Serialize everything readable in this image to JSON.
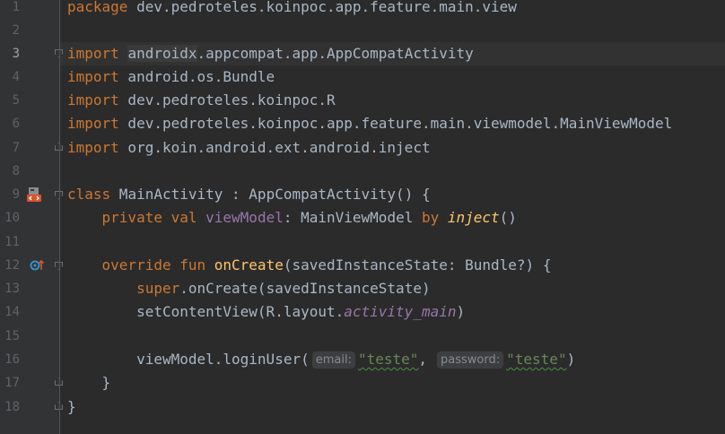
{
  "gutter": {
    "line_numbers": [
      "1",
      "2",
      "3",
      "4",
      "5",
      "6",
      "7",
      "8",
      "9",
      "10",
      "11",
      "12",
      "13",
      "14",
      "15",
      "16",
      "17",
      "18"
    ],
    "current_line": "3"
  },
  "code": {
    "line1": {
      "kw": "package",
      "text": " dev.pedroteles.koinpoc.app.feature.main.view"
    },
    "line3": {
      "kw": "import",
      "sp": " ",
      "hl": "androidx",
      "text": ".appcompat.app.AppCompatActivity"
    },
    "line4": {
      "kw": "import",
      "text": " android.os.Bundle"
    },
    "line5": {
      "kw": "import",
      "text": " dev.pedroteles.koinpoc.R"
    },
    "line6": {
      "kw": "import",
      "text": " dev.pedroteles.koinpoc.app.feature.main.viewmodel.MainViewModel"
    },
    "line7": {
      "kw": "import",
      "text": " org.koin.android.ext.android.inject"
    },
    "line9": {
      "kw": "class",
      "text": " MainActivity : AppCompatActivity() {"
    },
    "line10": {
      "indent": "    ",
      "kw": "private val",
      "sp": " ",
      "prop": "viewModel",
      "text": ": MainViewModel ",
      "kw2": "by",
      "sp2": " ",
      "ext": "inject",
      "text2": "()"
    },
    "line12": {
      "indent": "    ",
      "kw": "override fun",
      "sp": " ",
      "fn": "onCreate",
      "text": "(savedInstanceState: Bundle?) {"
    },
    "line13": {
      "indent": "        ",
      "kw": "super",
      "text": ".onCreate(savedInstanceState)"
    },
    "line14": {
      "indent": "        ",
      "text": "setContentView(R.layout.",
      "stat": "activity_main",
      "text2": ")"
    },
    "line16": {
      "indent": "        ",
      "text": "viewModel.loginUser(",
      "hint1": "email:",
      "str1": "\"teste\"",
      "comma": ",",
      "hint2": "password:",
      "str2": "\"teste\"",
      "text2": ")"
    },
    "line17": {
      "indent": "    ",
      "text": "}"
    },
    "line18": {
      "text": "}"
    }
  },
  "icons": {
    "line9": "activity-layout-icon",
    "line12": "override-method-icon"
  },
  "colors": {
    "background": "#2b2b2b",
    "gutter": "#313335",
    "keyword": "#cc7832",
    "function": "#ffc66d",
    "property": "#9876aa",
    "string": "#6a8759",
    "text": "#a9b7c6"
  }
}
